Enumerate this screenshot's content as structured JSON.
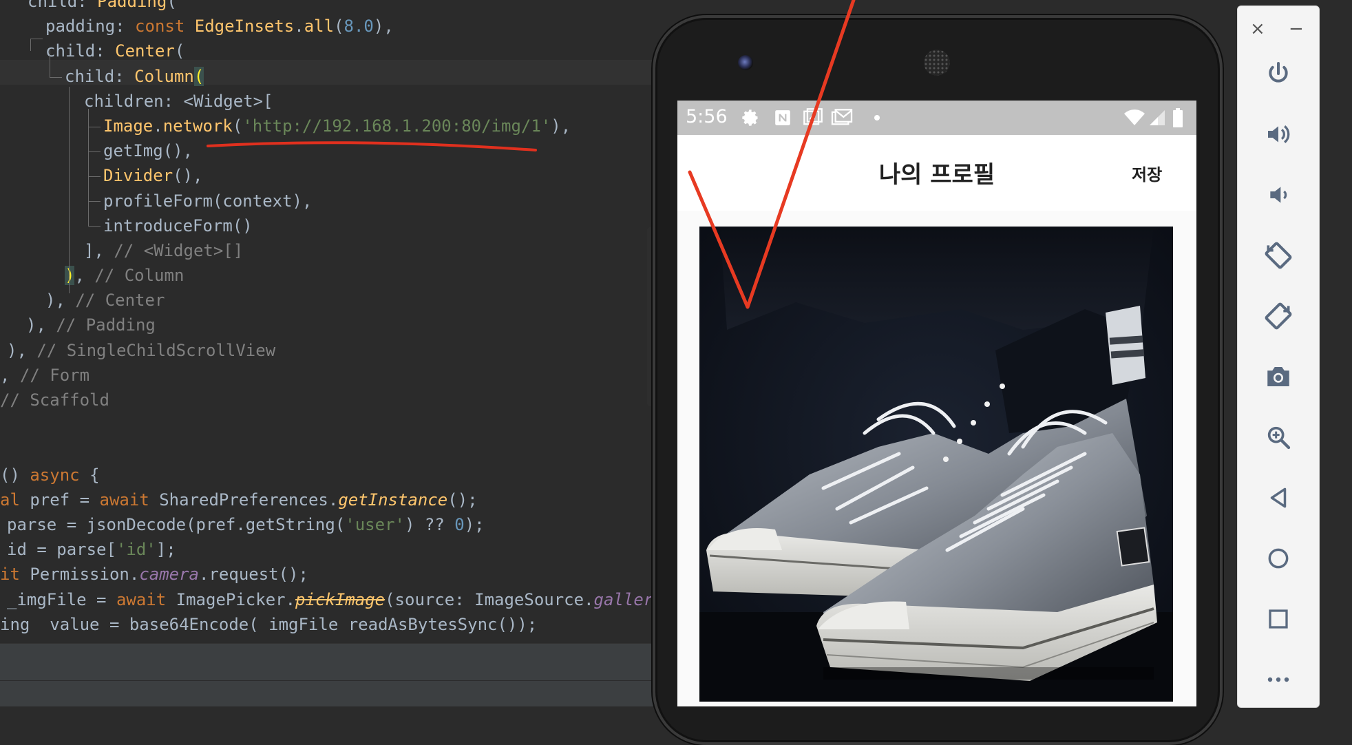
{
  "editor": {
    "lines": [
      {
        "indent": 40,
        "parts": [
          [
            "p",
            "child: "
          ],
          [
            "fn",
            "Padding"
          ],
          [
            "p",
            "("
          ]
        ]
      },
      {
        "indent": 66,
        "parts": [
          [
            "p",
            "padding: "
          ],
          [
            "kw",
            "const "
          ],
          [
            "fn",
            "EdgeInsets"
          ],
          [
            "p",
            "."
          ],
          [
            "fn",
            "all"
          ],
          [
            "p",
            "("
          ],
          [
            "num",
            "8.0"
          ],
          [
            "p",
            "),"
          ]
        ]
      },
      {
        "indent": 66,
        "parts": [
          [
            "p",
            "child: "
          ],
          [
            "fn",
            "Center"
          ],
          [
            "p",
            "("
          ]
        ]
      },
      {
        "indent": 94,
        "parts": [
          [
            "p",
            "child: "
          ],
          [
            "fn",
            "Column"
          ],
          [
            "hl",
            "("
          ]
        ]
      },
      {
        "indent": 122,
        "parts": [
          [
            "p",
            "children: <Widget>["
          ]
        ]
      },
      {
        "indent": 150,
        "parts": [
          [
            "fn",
            "Image"
          ],
          [
            "p",
            "."
          ],
          [
            "fn",
            "network"
          ],
          [
            "p",
            "("
          ],
          [
            "str",
            "'http://192.168.1.200:80/img/1'"
          ],
          [
            "p",
            "),"
          ]
        ]
      },
      {
        "indent": 150,
        "parts": [
          [
            "p",
            "getImg(),"
          ]
        ]
      },
      {
        "indent": 150,
        "parts": [
          [
            "fn",
            "Divider"
          ],
          [
            "p",
            "(),"
          ]
        ]
      },
      {
        "indent": 150,
        "parts": [
          [
            "p",
            "profileForm(context),"
          ]
        ]
      },
      {
        "indent": 150,
        "parts": [
          [
            "p",
            "introduceForm()"
          ]
        ]
      },
      {
        "indent": 122,
        "parts": [
          [
            "p",
            "], "
          ],
          [
            "cm",
            "// <Widget>[]"
          ]
        ]
      },
      {
        "indent": 94,
        "parts": [
          [
            "hl",
            ")"
          ],
          [
            "p",
            ", "
          ],
          [
            "cm",
            "// Column"
          ]
        ]
      },
      {
        "indent": 66,
        "parts": [
          [
            "p",
            "), "
          ],
          [
            "cm",
            "// Center"
          ]
        ]
      },
      {
        "indent": 38,
        "parts": [
          [
            "p",
            "), "
          ],
          [
            "cm",
            "// Padding"
          ]
        ]
      },
      {
        "indent": 10,
        "parts": [
          [
            "p",
            "), "
          ],
          [
            "cm",
            "// SingleChildScrollView"
          ]
        ]
      },
      {
        "indent": 0,
        "parts": [
          [
            "p",
            ", "
          ],
          [
            "cm",
            "// Form"
          ]
        ]
      },
      {
        "indent": 0,
        "parts": [
          [
            "cm",
            "// Scaffold"
          ]
        ]
      },
      {
        "indent": 0,
        "parts": []
      },
      {
        "indent": 0,
        "parts": []
      },
      {
        "indent": 0,
        "parts": [
          [
            "p",
            "() "
          ],
          [
            "kw",
            "async "
          ],
          [
            "p",
            "{"
          ]
        ]
      },
      {
        "indent": 0,
        "parts": [
          [
            "kw",
            "al "
          ],
          [
            "p",
            "pref = "
          ],
          [
            "kw",
            "await "
          ],
          [
            "p",
            "SharedPreferences."
          ],
          [
            "it",
            "getInstance"
          ],
          [
            "p",
            "();"
          ]
        ]
      },
      {
        "indent": 10,
        "parts": [
          [
            "p",
            "parse = jsonDecode(pref.getString("
          ],
          [
            "str",
            "'user'"
          ],
          [
            "p",
            ") ?? "
          ],
          [
            "num",
            "0"
          ],
          [
            "p",
            ");"
          ]
        ]
      },
      {
        "indent": 10,
        "parts": [
          [
            "p",
            "id = parse["
          ],
          [
            "str",
            "'id'"
          ],
          [
            "p",
            "];"
          ]
        ]
      },
      {
        "indent": 0,
        "parts": [
          [
            "kw",
            "it "
          ],
          [
            "p",
            "Permission."
          ],
          [
            "prop",
            "camera"
          ],
          [
            "p",
            ".request();"
          ]
        ]
      },
      {
        "indent": 10,
        "parts": [
          [
            "p",
            "_imgFile = "
          ],
          [
            "kw",
            "await "
          ],
          [
            "p",
            "ImagePicker."
          ],
          [
            "strike",
            "pickImage"
          ],
          [
            "p",
            "(source: ImageSource."
          ],
          [
            "prop",
            "gallery"
          ],
          [
            "p",
            ")"
          ]
        ]
      },
      {
        "indent": 0,
        "parts": [
          [
            "p",
            "ing  value = base64Encode( imgFile readAsBytesSync());"
          ]
        ]
      }
    ]
  },
  "device": {
    "status_time": "5:56",
    "status_icons": [
      "gear-icon",
      "n-icon",
      "image-icon",
      "mail-icon",
      "dot-icon",
      "wifi-icon",
      "signal-icon",
      "battery-icon"
    ],
    "app_title": "나의 프로필",
    "save_label": "저장"
  },
  "toolbar": {
    "close_label": "×",
    "minimize_label": "−",
    "buttons": [
      "power-icon",
      "volume-up-icon",
      "volume-down-icon",
      "rotate-left-icon",
      "rotate-right-icon",
      "camera-icon",
      "zoom-icon",
      "back-icon",
      "home-icon",
      "overview-icon",
      "more-icon"
    ]
  }
}
